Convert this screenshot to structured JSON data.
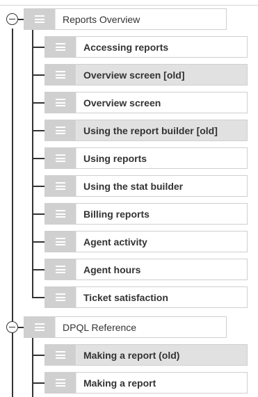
{
  "tree": {
    "sections": [
      {
        "title": "Reports Overview",
        "items": [
          {
            "label": "Accessing reports",
            "highlighted": false
          },
          {
            "label": "Overview screen [old]",
            "highlighted": true
          },
          {
            "label": "Overview screen",
            "highlighted": false
          },
          {
            "label": "Using the report builder [old]",
            "highlighted": true
          },
          {
            "label": "Using reports",
            "highlighted": false
          },
          {
            "label": "Using the stat builder",
            "highlighted": false
          },
          {
            "label": "Billing reports",
            "highlighted": false
          },
          {
            "label": "Agent activity",
            "highlighted": false
          },
          {
            "label": "Agent hours",
            "highlighted": false
          },
          {
            "label": "Ticket satisfaction",
            "highlighted": false
          }
        ]
      },
      {
        "title": "DPQL Reference",
        "items": [
          {
            "label": "Making a report (old)",
            "highlighted": true
          },
          {
            "label": "Making a report",
            "highlighted": false
          }
        ]
      }
    ]
  },
  "icons": {
    "toggle": "collapse-minus-icon",
    "handle": "drag-handle-icon"
  }
}
